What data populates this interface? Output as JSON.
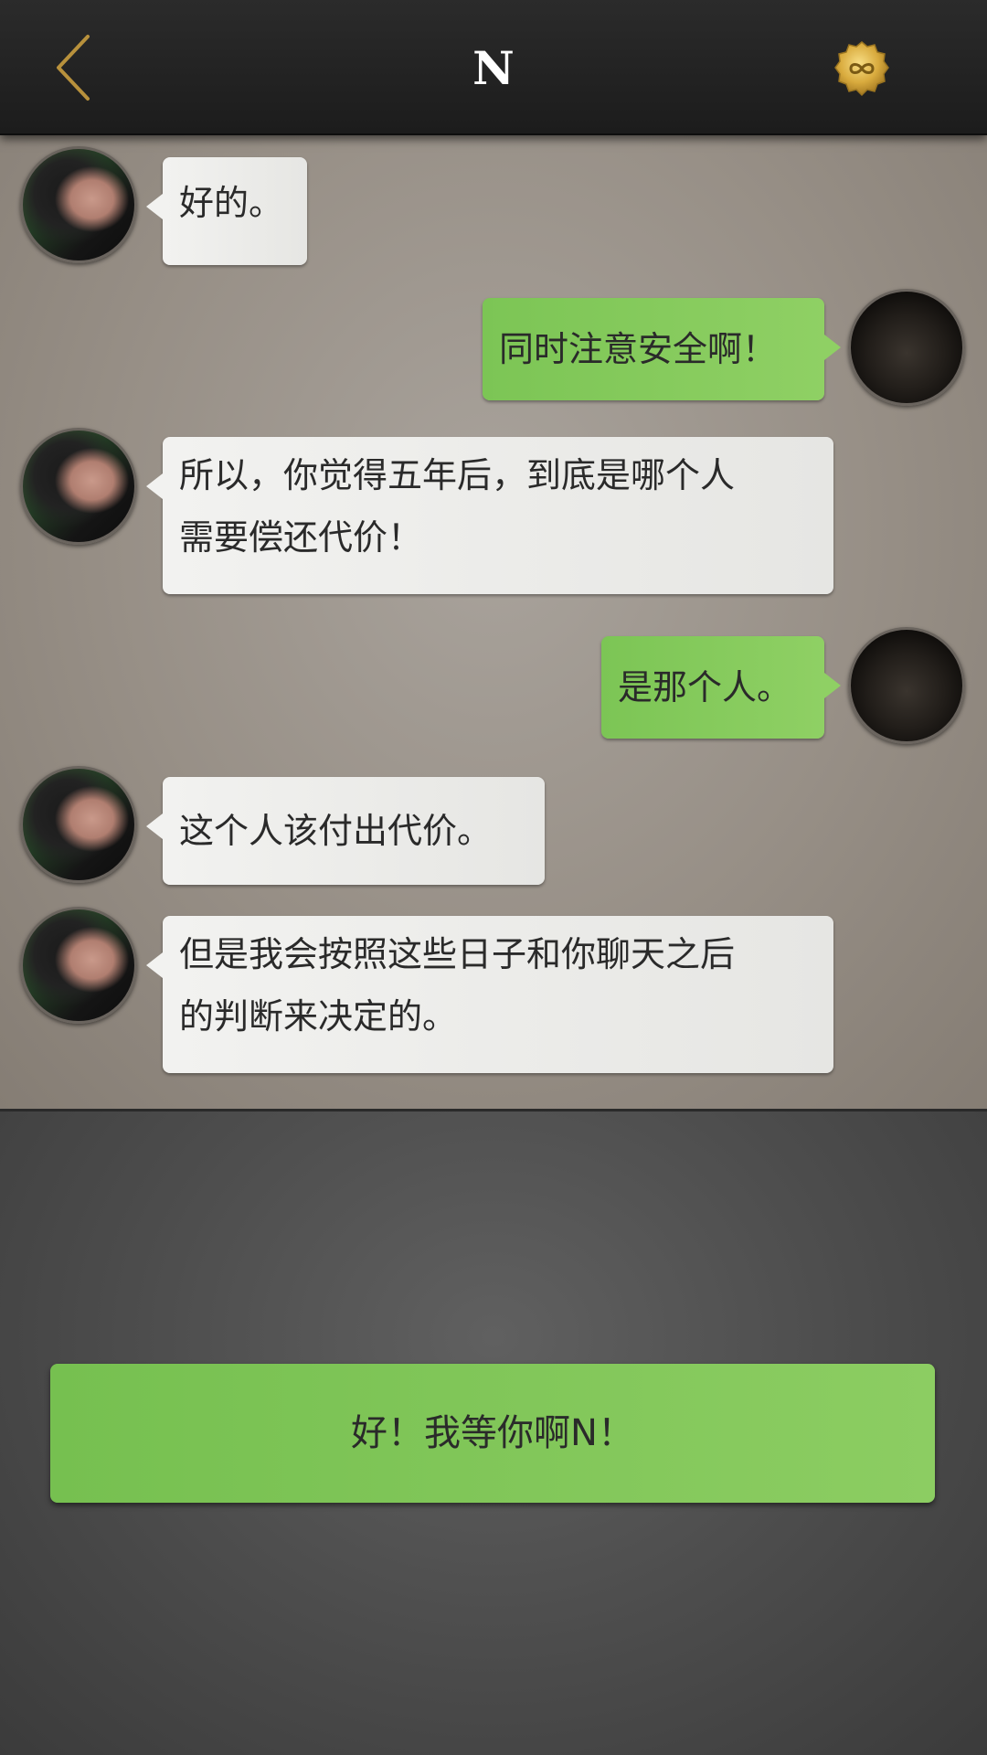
{
  "header": {
    "back_icon": "chevron-left-icon",
    "title": "N",
    "badge_icon": "infinity-icon"
  },
  "colors": {
    "header_bg": "#222222",
    "accent_gold": "#c8a040",
    "incoming_bubble": "#efefed",
    "outgoing_bubble": "#84c95a",
    "reply_button": "#84c95a"
  },
  "messages": [
    {
      "sender": "N",
      "text": "好的。"
    },
    {
      "sender": "me",
      "text": "同时注意安全啊！"
    },
    {
      "sender": "N",
      "line1": "所以，你觉得五年后，到底是哪个人",
      "line2": "需要偿还代价！"
    },
    {
      "sender": "me",
      "text": "是那个人。"
    },
    {
      "sender": "N",
      "text": "这个人该付出代价。"
    },
    {
      "sender": "N",
      "line1": "但是我会按照这些日子和你聊天之后",
      "line2": "的判断来决定的。"
    }
  ],
  "reply_option": {
    "label": "好！我等你啊N！"
  }
}
